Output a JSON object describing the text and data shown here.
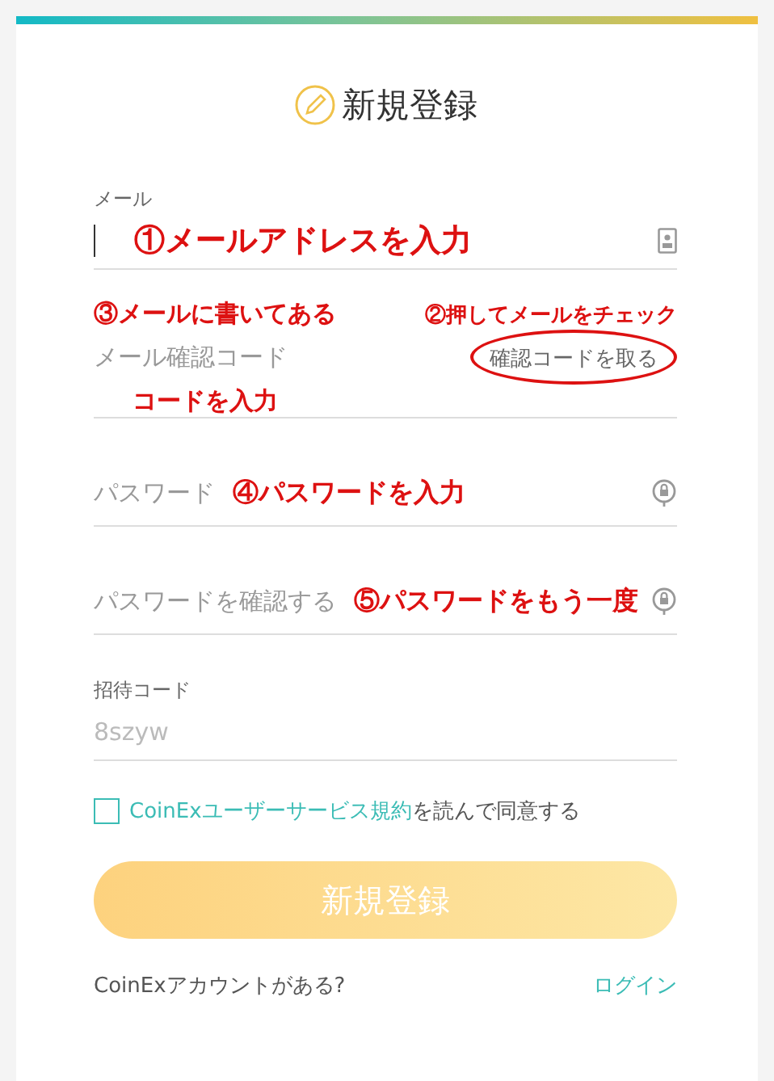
{
  "title": {
    "text": "新規登録"
  },
  "fields": [
    {
      "kind": "email",
      "label": "メール",
      "annotation": "①メールアドレスを入力"
    },
    {
      "kind": "code",
      "placeholder": "メール確認コード",
      "action": "確認コードを取る",
      "annotation_top": "③メールに書いてある",
      "annotation_bottom": "コードを入力",
      "action_annotation": "②押してメールをチェック"
    },
    {
      "kind": "password",
      "placeholder": "パスワード",
      "annotation": "④パスワードを入力"
    },
    {
      "kind": "password",
      "placeholder": "パスワードを確認する",
      "annotation": "⑤パスワードをもう一度"
    },
    {
      "kind": "invite",
      "label": "招待コード",
      "placeholder": "8szyw"
    }
  ],
  "agreement": {
    "checked": false,
    "link": "CoinExユーザーサービス規約",
    "text": "を読んで同意する"
  },
  "submit": {
    "label": "新規登録",
    "disabled": true
  },
  "footer": {
    "question": "CoinExアカウントがある?",
    "link": "ログイン"
  }
}
